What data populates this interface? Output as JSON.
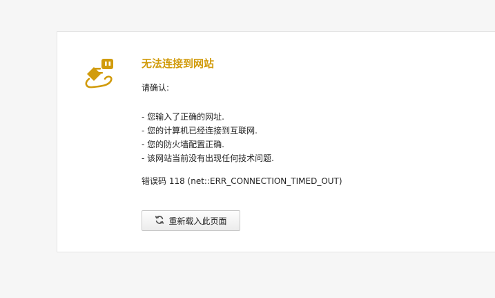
{
  "error_page": {
    "title": "无法连接到网站",
    "confirm_label": "请确认:",
    "checklist": [
      "- 您输入了正确的网址.",
      "- 您的计算机已经连接到互联网.",
      "- 您的防火墙配置正确.",
      "- 该网站当前没有出现任何技术问题."
    ],
    "error_code": "错误码 118 (net::ERR_CONNECTION_TIMED_OUT)",
    "reload_label": "重新载入此页面",
    "icon": "plug-icon",
    "reload_icon": "refresh-icon",
    "colors": {
      "accent": "#d19b0c",
      "background": "#f6f6f6",
      "card": "#ffffff"
    }
  }
}
